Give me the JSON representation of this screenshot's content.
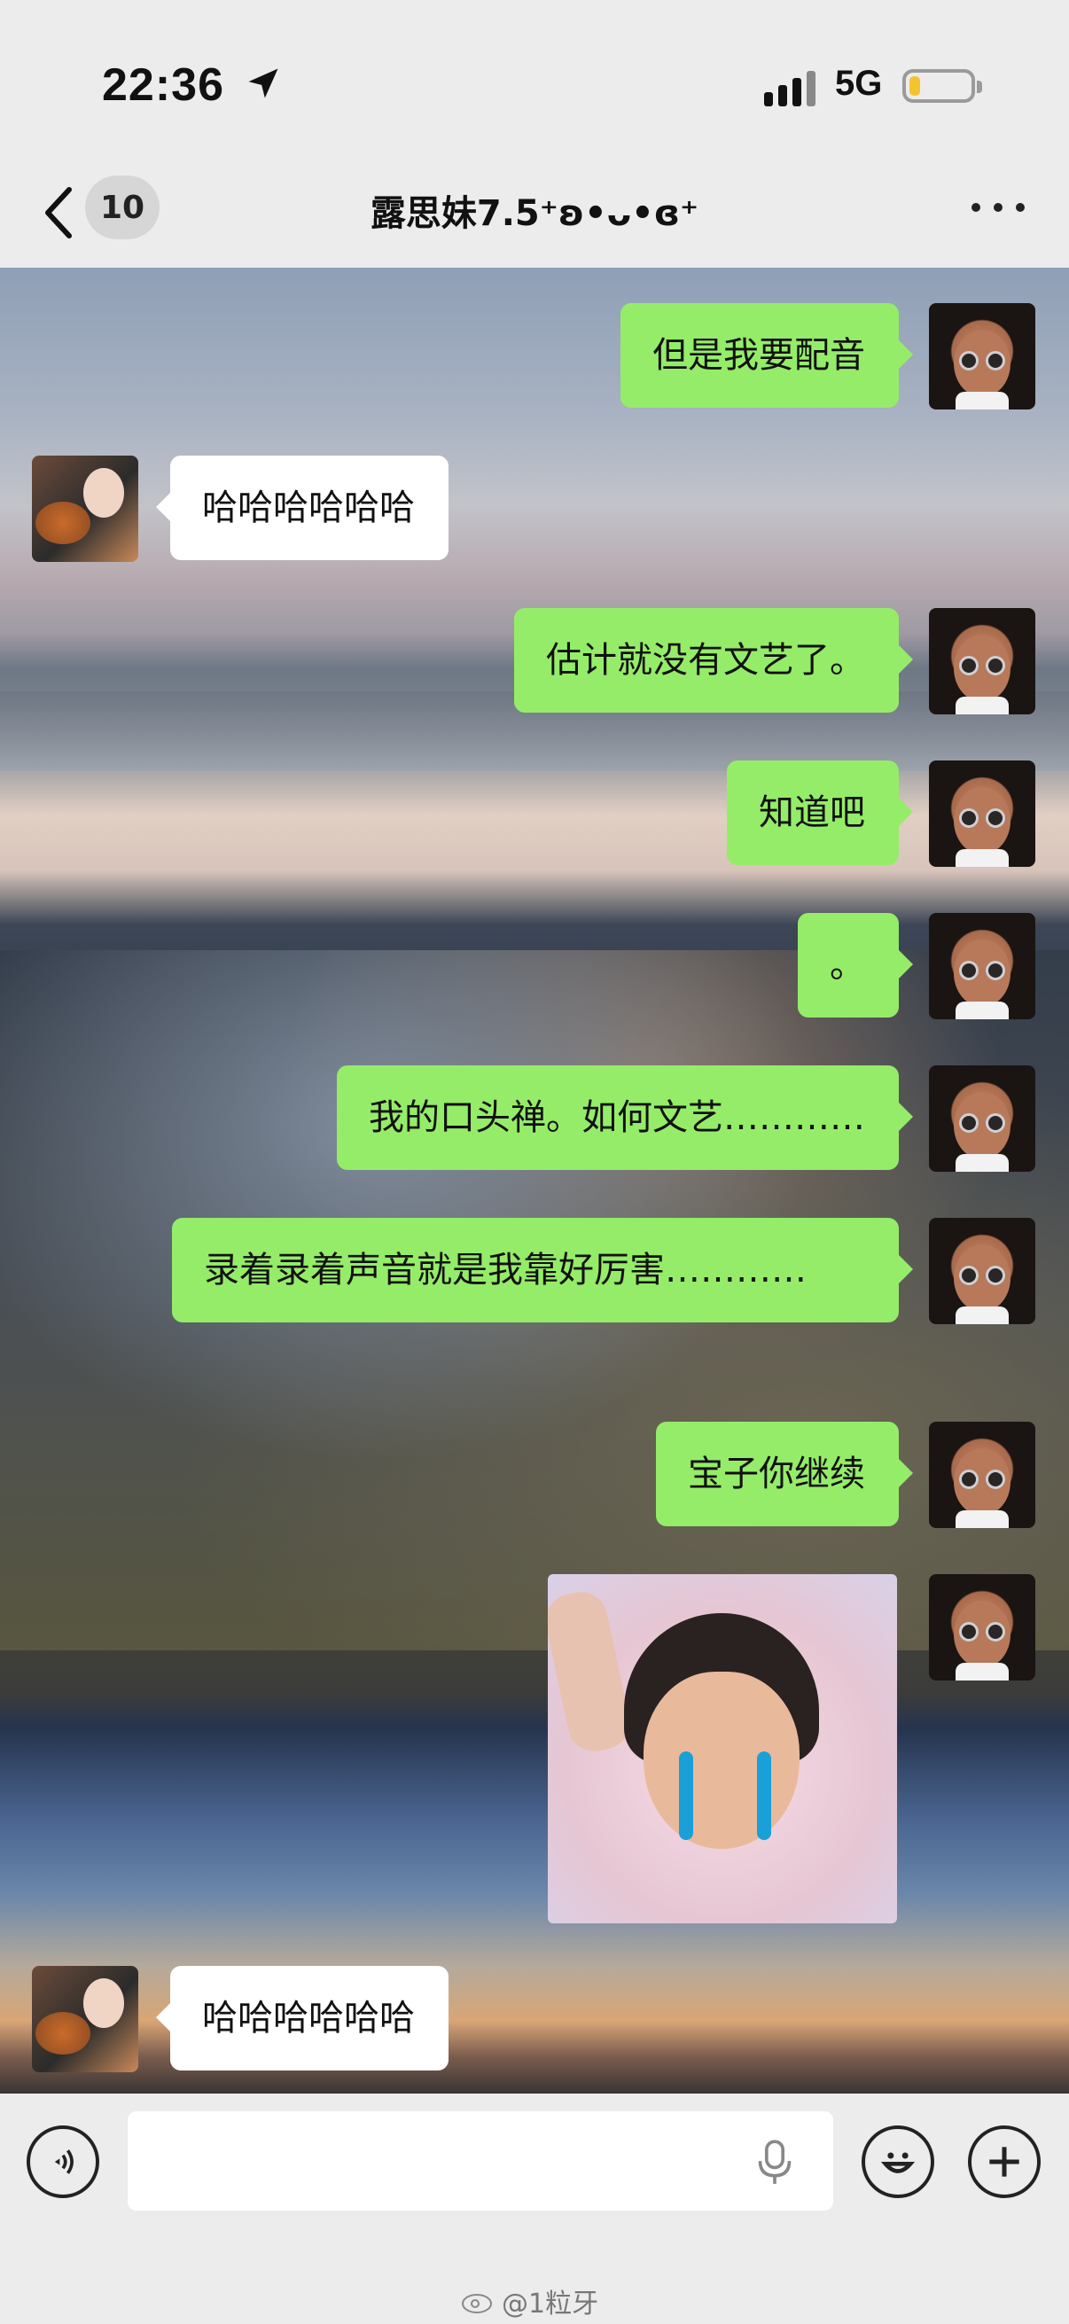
{
  "status": {
    "time": "22:36",
    "network": "5G"
  },
  "nav": {
    "back_count": "10",
    "title": "露思妹7.5⁺ʚ•ᴗ•ɞ⁺"
  },
  "messages": [
    {
      "from": "me",
      "text": "但是我要配音"
    },
    {
      "from": "other",
      "text": "哈哈哈哈哈哈"
    },
    {
      "from": "me",
      "text": "估计就没有文艺了。"
    },
    {
      "from": "me",
      "text": "知道吧"
    },
    {
      "from": "me",
      "text": "。"
    },
    {
      "from": "me",
      "text": "我的口头禅。如何文艺…………"
    },
    {
      "from": "me",
      "text": "录着录着声音就是我靠好厉害…………"
    },
    {
      "from": "me",
      "text": "宝子你继续"
    },
    {
      "from": "me",
      "type": "sticker",
      "icon": "crying-boy-sticker"
    },
    {
      "from": "other",
      "text": "哈哈哈哈哈哈"
    }
  ],
  "input": {
    "value": "",
    "placeholder": ""
  },
  "watermark": "@1粒牙",
  "colors": {
    "my_bubble": "#95ec69",
    "other_bubble": "#ffffff",
    "battery": "#f4c430"
  }
}
